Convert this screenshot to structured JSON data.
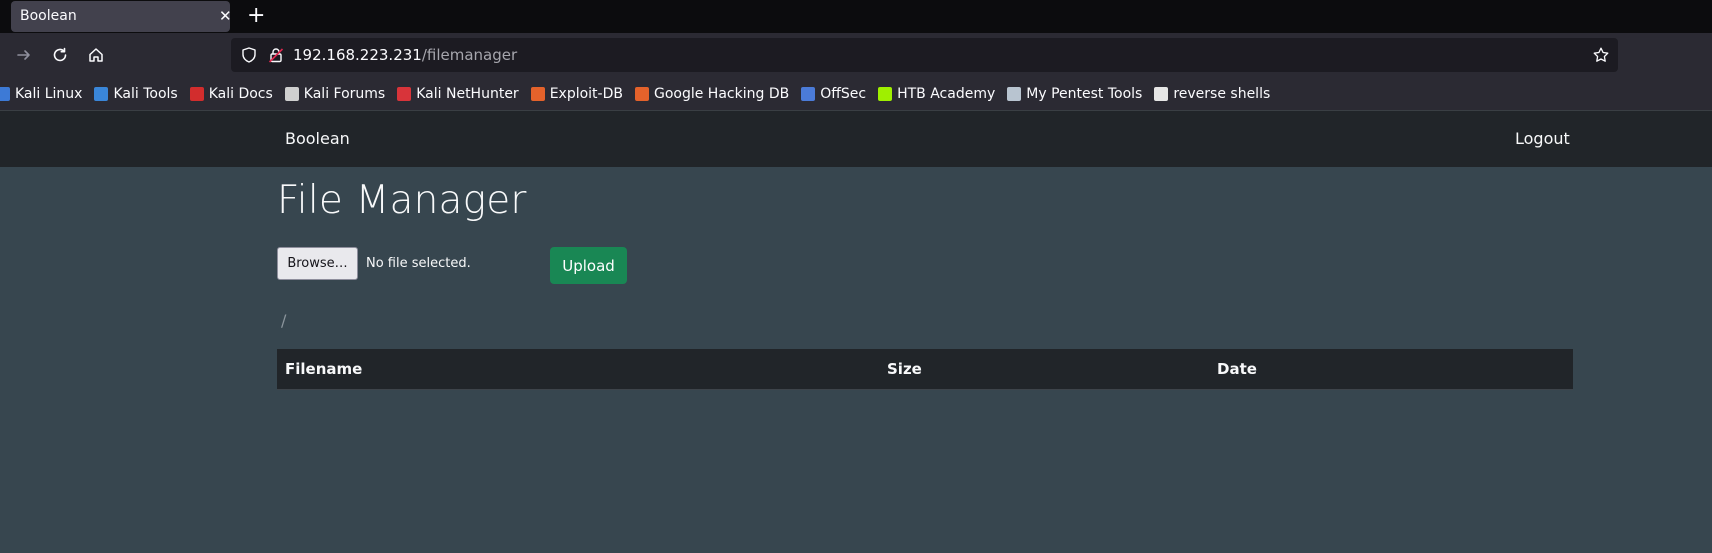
{
  "browser": {
    "tab_title": "Boolean",
    "tab_close": "✕",
    "new_tab": "+",
    "url_host": "192.168.223.231",
    "url_path": "/filemanager"
  },
  "bookmarks": [
    {
      "label": "Kali Linux",
      "icon": "kali-dragon-icon",
      "color": "#3d7ad6"
    },
    {
      "label": "Kali Tools",
      "icon": "kali-tools-icon",
      "color": "#3a86d9"
    },
    {
      "label": "Kali Docs",
      "icon": "kali-docs-icon",
      "color": "#d22d2d"
    },
    {
      "label": "Kali Forums",
      "icon": "kali-forums-icon",
      "color": "#cfcfcf"
    },
    {
      "label": "Kali NetHunter",
      "icon": "nethunter-icon",
      "color": "#d8343a"
    },
    {
      "label": "Exploit-DB",
      "icon": "exploit-db-icon",
      "color": "#e4622b"
    },
    {
      "label": "Google Hacking DB",
      "icon": "ghdb-icon",
      "color": "#e4622b"
    },
    {
      "label": "OffSec",
      "icon": "offsec-icon",
      "color": "#4b7bd8"
    },
    {
      "label": "HTB Academy",
      "icon": "htb-icon",
      "color": "#9fef00"
    },
    {
      "label": "My Pentest Tools",
      "icon": "pentest-tools-icon",
      "color": "#b8c4d0"
    },
    {
      "label": "reverse shells",
      "icon": "github-icon",
      "color": "#e6e6e6"
    }
  ],
  "app": {
    "brand": "Boolean",
    "logout": "Logout",
    "title": "File Manager",
    "browse_label": "Browse…",
    "file_status": "No file selected.",
    "upload_label": "Upload",
    "current_path": "/",
    "table_headers": [
      "Filename",
      "Size",
      "Date"
    ],
    "upload_color": "#198754"
  }
}
